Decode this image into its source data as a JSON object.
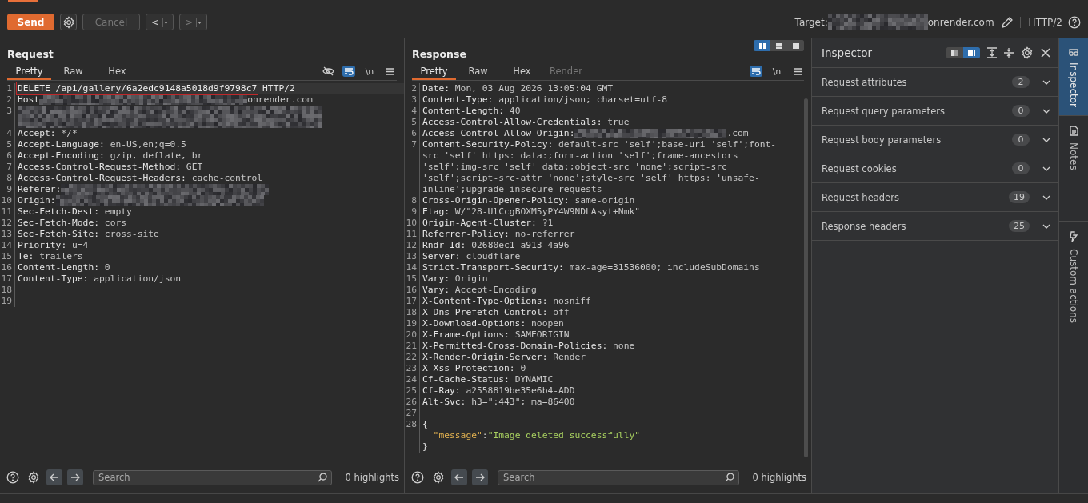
{
  "toolbar": {
    "send": "Send",
    "cancel": {
      "label": "Cancel",
      "disabled": true
    },
    "back": "<",
    "forward": ">",
    "target_label": "Target:",
    "target_value": "onrender.com",
    "protocol": "HTTP/2"
  },
  "request": {
    "title": "Request",
    "tabs": [
      {
        "label": "Pretty",
        "selected": true
      },
      {
        "label": "Raw",
        "selected": false
      },
      {
        "label": "Hex",
        "selected": false
      }
    ],
    "tools": {
      "hide_on": false,
      "wrap_on": true,
      "newline": "\\n"
    },
    "lines": [
      {
        "n": "1",
        "kind": "request-line",
        "boxed": "DELETE /api/gallery/6a2edc9148a5018d9f9798c7",
        "rest": "HTTP/2"
      },
      {
        "n": "2",
        "kind": "redacted-header",
        "name": "Host",
        "value": "onrender.com"
      },
      {
        "n": "3",
        "kind": "redacted"
      },
      {
        "n": "4",
        "kind": "header",
        "name": "Accept:",
        "value": "*/*"
      },
      {
        "n": "5",
        "kind": "header",
        "name": "Accept-Language:",
        "value": "en-US,en;q=0.5"
      },
      {
        "n": "6",
        "kind": "header",
        "name": "Accept-Encoding:",
        "value": "gzip, deflate, br"
      },
      {
        "n": "7",
        "kind": "header",
        "name": "Access-Control-Request-Method:",
        "value": "GET"
      },
      {
        "n": "8",
        "kind": "header",
        "name": "Access-Control-Request-Headers:",
        "value": "cache-control"
      },
      {
        "n": "9",
        "kind": "redacted-header",
        "name": "Referer:"
      },
      {
        "n": "10",
        "kind": "redacted-header",
        "name": "Origin:"
      },
      {
        "n": "11",
        "kind": "header",
        "name": "Sec-Fetch-Dest:",
        "value": "empty"
      },
      {
        "n": "12",
        "kind": "header",
        "name": "Sec-Fetch-Mode:",
        "value": "cors"
      },
      {
        "n": "13",
        "kind": "header",
        "name": "Sec-Fetch-Site:",
        "value": "cross-site"
      },
      {
        "n": "14",
        "kind": "header",
        "name": "Priority:",
        "value": "u=4"
      },
      {
        "n": "15",
        "kind": "header",
        "name": "Te:",
        "value": "trailers"
      },
      {
        "n": "16",
        "kind": "header",
        "name": "Content-Length:",
        "value": "0"
      },
      {
        "n": "17",
        "kind": "header",
        "name": "Content-Type:",
        "value": "application/json"
      },
      {
        "n": "18",
        "kind": "empty"
      },
      {
        "n": "19",
        "kind": "empty"
      }
    ],
    "search": {
      "placeholder": "Search"
    },
    "highlights": "0 highlights"
  },
  "response": {
    "title": "Response",
    "layouts": [
      {
        "selected": true
      },
      {
        "selected": false
      },
      {
        "selected": false
      }
    ],
    "tabs": [
      {
        "label": "Pretty",
        "selected": true,
        "disabled": false
      },
      {
        "label": "Raw",
        "selected": false,
        "disabled": false
      },
      {
        "label": "Hex",
        "selected": false,
        "disabled": false
      },
      {
        "label": "Render",
        "selected": false,
        "disabled": true
      }
    ],
    "tools": {
      "wrap_on": true,
      "newline": "\\n"
    },
    "lines": [
      {
        "n": "2",
        "kind": "header",
        "name": "Date:",
        "value": "Mon, 03 Aug 2026 13:05:04 GMT"
      },
      {
        "n": "3",
        "kind": "header",
        "name": "Content-Type:",
        "value": "application/json; charset=utf-8"
      },
      {
        "n": "4",
        "kind": "header",
        "name": "Content-Length:",
        "value": "40"
      },
      {
        "n": "5",
        "kind": "header",
        "name": "Access-Control-Allow-Credentials:",
        "value": "true"
      },
      {
        "n": "6",
        "kind": "redacted-header",
        "name": "Access-Control-Allow-Origin:",
        "value": ".com"
      },
      {
        "n": "7",
        "kind": "header",
        "name": "Content-Security-Policy:",
        "value": "default-src 'self';base-uri 'self';font-src 'self' https: data:;form-action 'self';frame-ancestors 'self';img-src 'self' data:;object-src 'none';script-src 'self';script-src-attr 'none';style-src 'self' https: 'unsafe-inline';upgrade-insecure-requests"
      },
      {
        "n": "8",
        "kind": "header",
        "name": "Cross-Origin-Opener-Policy:",
        "value": "same-origin"
      },
      {
        "n": "9",
        "kind": "header",
        "name": "Etag:",
        "value": "W/\"28-UlCcgBOXM5yPY4W9NDLAsyt+Nmk\""
      },
      {
        "n": "10",
        "kind": "header",
        "name": "Origin-Agent-Cluster:",
        "value": "?1"
      },
      {
        "n": "11",
        "kind": "header",
        "name": "Referrer-Policy:",
        "value": "no-referrer"
      },
      {
        "n": "12",
        "kind": "header",
        "name": "Rndr-Id:",
        "value": "02680ec1-a913-4a96"
      },
      {
        "n": "13",
        "kind": "header",
        "name": "Server:",
        "value": "cloudflare"
      },
      {
        "n": "14",
        "kind": "header",
        "name": "Strict-Transport-Security:",
        "value": "max-age=31536000; includeSubDomains"
      },
      {
        "n": "15",
        "kind": "header",
        "name": "Vary:",
        "value": "Origin"
      },
      {
        "n": "16",
        "kind": "header",
        "name": "Vary:",
        "value": "Accept-Encoding"
      },
      {
        "n": "17",
        "kind": "header",
        "name": "X-Content-Type-Options:",
        "value": "nosniff"
      },
      {
        "n": "18",
        "kind": "header",
        "name": "X-Dns-Prefetch-Control:",
        "value": "off"
      },
      {
        "n": "19",
        "kind": "header",
        "name": "X-Download-Options:",
        "value": "noopen"
      },
      {
        "n": "20",
        "kind": "header",
        "name": "X-Frame-Options:",
        "value": "SAMEORIGIN"
      },
      {
        "n": "21",
        "kind": "header",
        "name": "X-Permitted-Cross-Domain-Policies:",
        "value": "none"
      },
      {
        "n": "22",
        "kind": "header",
        "name": "X-Render-Origin-Server:",
        "value": "Render"
      },
      {
        "n": "23",
        "kind": "header",
        "name": "X-Xss-Protection:",
        "value": "0"
      },
      {
        "n": "24",
        "kind": "header",
        "name": "Cf-Cache-Status:",
        "value": "DYNAMIC"
      },
      {
        "n": "25",
        "kind": "header",
        "name": "Cf-Ray:",
        "value": "a2558819be35e6b4-ADD"
      },
      {
        "n": "26",
        "kind": "header",
        "name": "Alt-Svc:",
        "value": "h3=\":443\"; ma=86400"
      },
      {
        "n": "27",
        "kind": "empty"
      },
      {
        "n": "28",
        "kind": "json-brace",
        "text": "{"
      },
      {
        "kind": "json-pair",
        "key": "\"message\"",
        "sep": ":",
        "value": "\"Image deleted successfully\""
      },
      {
        "kind": "json-brace",
        "text": "}"
      }
    ],
    "search": {
      "placeholder": "Search"
    },
    "highlights": "0 highlights"
  },
  "inspector": {
    "title": "Inspector",
    "layouts": [
      {
        "selected": false
      },
      {
        "selected": true
      }
    ],
    "sections": [
      {
        "label": "Request attributes",
        "count": "2"
      },
      {
        "label": "Request query parameters",
        "count": "0"
      },
      {
        "label": "Request body parameters",
        "count": "0"
      },
      {
        "label": "Request cookies",
        "count": "0"
      },
      {
        "label": "Request headers",
        "count": "19"
      },
      {
        "label": "Response headers",
        "count": "25"
      }
    ]
  },
  "side_tabs": [
    {
      "label": "Inspector",
      "selected": true
    },
    {
      "label": "Notes",
      "selected": false
    },
    {
      "label": "Custom actions",
      "selected": false
    }
  ]
}
